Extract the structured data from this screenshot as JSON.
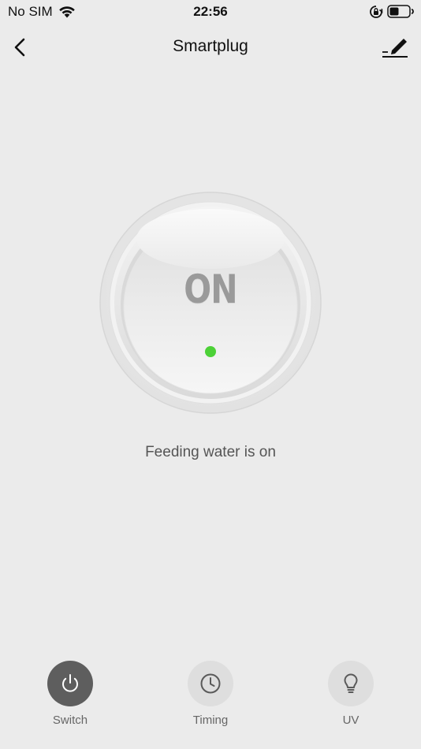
{
  "status_bar": {
    "carrier": "No SIM",
    "time": "22:56",
    "icons": [
      "wifi-icon",
      "orientation-lock-icon",
      "battery-icon"
    ]
  },
  "nav": {
    "title": "Smartplug",
    "back_icon": "chevron-left-icon",
    "edit_icon": "pencil-icon"
  },
  "switch": {
    "state_label": "ON",
    "indicator_color": "#4cd137",
    "status_text": "Feeding water is on"
  },
  "tabs": [
    {
      "label": "Switch",
      "icon": "power-icon",
      "active": true
    },
    {
      "label": "Timing",
      "icon": "clock-icon",
      "active": false
    },
    {
      "label": "UV",
      "icon": "lightbulb-icon",
      "active": false
    }
  ],
  "colors": {
    "background": "#ebebeb",
    "active_tab": "#5e5e5e",
    "inactive_tab": "#dedede"
  }
}
